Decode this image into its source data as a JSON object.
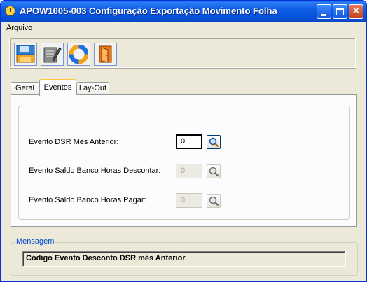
{
  "window": {
    "title": "APOW1005-003 Configuração Exportação Movimento Folha"
  },
  "menu": {
    "arquivo_accel": "A",
    "arquivo_rest": "rquivo"
  },
  "toolbar": {
    "buttons": [
      {
        "icon": "save-icon"
      },
      {
        "icon": "edit-icon"
      },
      {
        "icon": "help-lifebuoy-icon"
      },
      {
        "icon": "exit-door-icon"
      }
    ]
  },
  "tabs": [
    {
      "label": "Geral",
      "active": false
    },
    {
      "label": "Eventos",
      "active": true
    },
    {
      "label": "Lay-Out",
      "active": false
    }
  ],
  "fields": [
    {
      "label": "Evento DSR Mês Anterior:",
      "value": "0",
      "enabled": true
    },
    {
      "label": "Evento Saldo Banco Horas Descontar:",
      "value": "0",
      "enabled": false
    },
    {
      "label": "Evento Saldo Banco Horas Pagar:",
      "value": "0",
      "enabled": false
    }
  ],
  "message": {
    "legend": "Mensagem",
    "text": "Código Evento Desconto DSR mês Anterior"
  },
  "colors": {
    "titlebar": "#0a5fe8",
    "legend": "#0046d5",
    "active_tab_accent": "#ffc83c"
  }
}
